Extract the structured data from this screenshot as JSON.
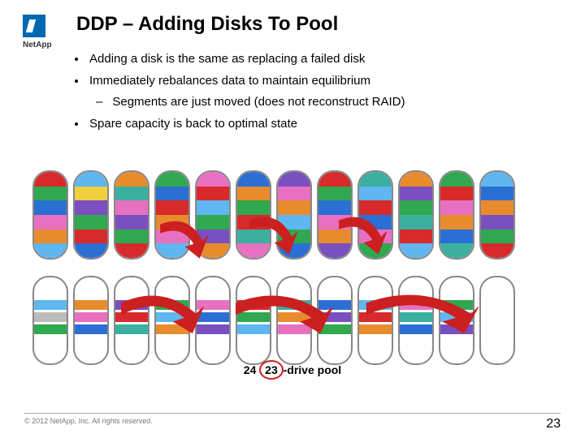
{
  "logo": {
    "wordmark": "NetApp"
  },
  "title": "DDP – Adding Disks To Pool",
  "bullets": {
    "b1": "Adding a disk is the same as replacing a failed disk",
    "b2": "Immediately rebalances data to maintain equilibrium",
    "b2a": "Segments are just moved (does not reconstruct RAID)",
    "b3": "Spare capacity is back to optimal state"
  },
  "caption": {
    "prefix": "24",
    "struck": "23",
    "suffix": "-drive pool"
  },
  "footer": {
    "copyright": "© 2012 NetApp, Inc. All rights reserved.",
    "page": "23"
  }
}
